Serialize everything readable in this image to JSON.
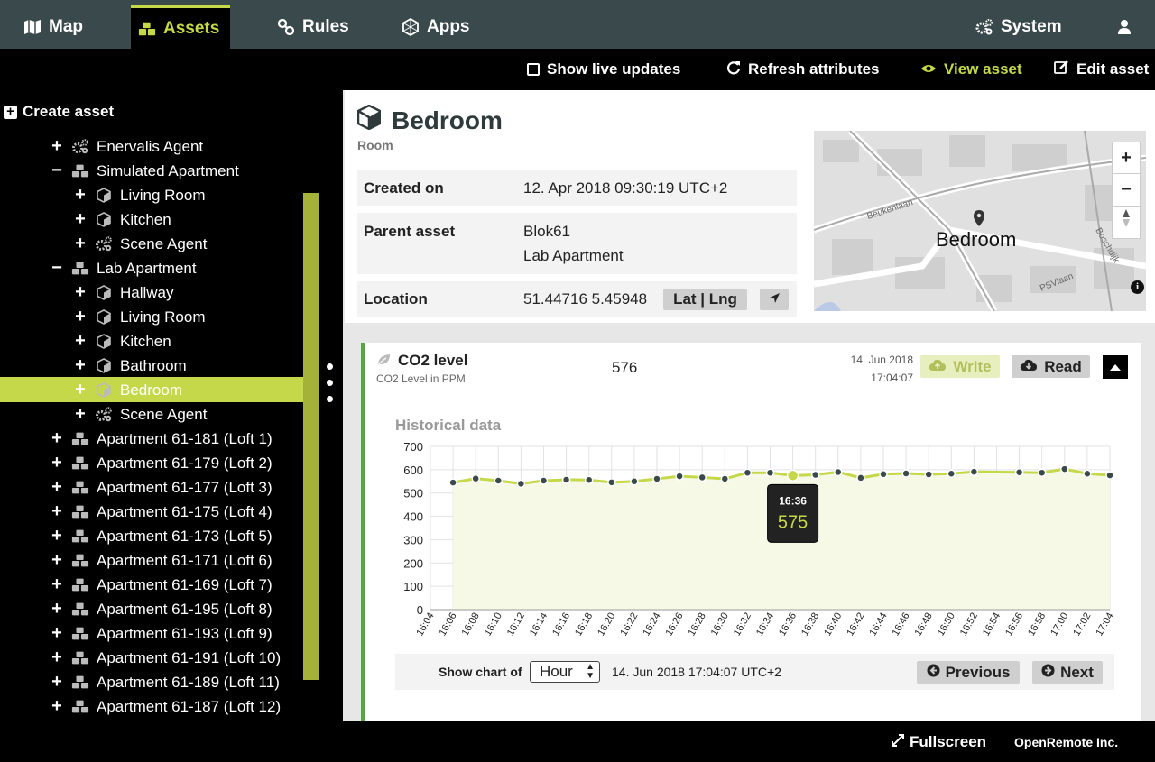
{
  "nav": {
    "items": [
      {
        "label": "Map",
        "icon": "map-icon"
      },
      {
        "label": "Assets",
        "icon": "cubes-icon"
      },
      {
        "label": "Rules",
        "icon": "link-icon"
      },
      {
        "label": "Apps",
        "icon": "apps-icon"
      }
    ],
    "system_label": "System",
    "accent": "#c4d84a"
  },
  "toolbar": {
    "live_updates": "Show live updates",
    "refresh": "Refresh attributes",
    "view": "View asset",
    "edit": "Edit asset"
  },
  "sidebar": {
    "create_label": "Create asset",
    "items": [
      {
        "label": "Enervalis Agent",
        "toggle": "+",
        "icon": "gears-icon",
        "level": 1
      },
      {
        "label": "Simulated Apartment",
        "toggle": "−",
        "icon": "cubes-icon",
        "level": 1
      },
      {
        "label": "Living Room",
        "toggle": "+",
        "icon": "cube-icon",
        "level": 2
      },
      {
        "label": "Kitchen",
        "toggle": "+",
        "icon": "cube-icon",
        "level": 2
      },
      {
        "label": "Scene Agent",
        "toggle": "+",
        "icon": "gears-icon",
        "level": 2
      },
      {
        "label": "Lab Apartment",
        "toggle": "−",
        "icon": "cubes-icon",
        "level": 1
      },
      {
        "label": "Hallway",
        "toggle": "+",
        "icon": "cube-icon",
        "level": 2
      },
      {
        "label": "Living Room",
        "toggle": "+",
        "icon": "cube-icon",
        "level": 2
      },
      {
        "label": "Kitchen",
        "toggle": "+",
        "icon": "cube-icon",
        "level": 2
      },
      {
        "label": "Bathroom",
        "toggle": "+",
        "icon": "cube-icon",
        "level": 2
      },
      {
        "label": "Bedroom",
        "toggle": "+",
        "icon": "cube-icon",
        "level": 2,
        "selected": true
      },
      {
        "label": "Scene Agent",
        "toggle": "+",
        "icon": "gears-icon",
        "level": 2
      },
      {
        "label": "Apartment 61-181 (Loft 1)",
        "toggle": "+",
        "icon": "cubes-icon",
        "level": 1
      },
      {
        "label": "Apartment 61-179 (Loft 2)",
        "toggle": "+",
        "icon": "cubes-icon",
        "level": 1
      },
      {
        "label": "Apartment 61-177 (Loft 3)",
        "toggle": "+",
        "icon": "cubes-icon",
        "level": 1
      },
      {
        "label": "Apartment 61-175 (Loft 4)",
        "toggle": "+",
        "icon": "cubes-icon",
        "level": 1
      },
      {
        "label": "Apartment 61-173 (Loft 5)",
        "toggle": "+",
        "icon": "cubes-icon",
        "level": 1
      },
      {
        "label": "Apartment 61-171 (Loft 6)",
        "toggle": "+",
        "icon": "cubes-icon",
        "level": 1
      },
      {
        "label": "Apartment 61-169 (Loft 7)",
        "toggle": "+",
        "icon": "cubes-icon",
        "level": 1
      },
      {
        "label": "Apartment 61-195 (Loft 8)",
        "toggle": "+",
        "icon": "cubes-icon",
        "level": 1
      },
      {
        "label": "Apartment 61-193 (Loft 9)",
        "toggle": "+",
        "icon": "cubes-icon",
        "level": 1
      },
      {
        "label": "Apartment 61-191 (Loft 10)",
        "toggle": "+",
        "icon": "cubes-icon",
        "level": 1
      },
      {
        "label": "Apartment 61-189 (Loft 11)",
        "toggle": "+",
        "icon": "cubes-icon",
        "level": 1
      },
      {
        "label": "Apartment 61-187 (Loft 12)",
        "toggle": "+",
        "icon": "cubes-icon",
        "level": 1
      }
    ]
  },
  "asset": {
    "name": "Bedroom",
    "type": "Room",
    "created_label": "Created on",
    "created_value": "12. Apr 2018 09:30:19 UTC+2",
    "parent_label": "Parent asset",
    "parent_line1": "Blok61",
    "parent_line2": "Lab Apartment",
    "location_label": "Location",
    "location_value": "51.44716 5.45948",
    "latlng_label": "Lat | Lng"
  },
  "map": {
    "marker_label": "Bedroom",
    "zoom_in": "+",
    "zoom_out": "−",
    "street1": "Beukenlaan",
    "street2": "Boschdijk",
    "street3": "PSVlaan"
  },
  "attribute": {
    "name": "CO2 level",
    "description": "CO2 Level in PPM",
    "value": "576",
    "time_date": "14. Jun 2018",
    "time_clock": "17:04:07",
    "write_label": "Write",
    "read_label": "Read",
    "history_title": "Historical data",
    "chart_footer": {
      "show_label": "Show chart of",
      "period": "Hour",
      "date": "14. Jun 2018 17:04:07 UTC+2",
      "prev_label": "Previous",
      "next_label": "Next"
    }
  },
  "chart_data": {
    "type": "line",
    "title": "Historical data",
    "xlabel": "",
    "ylabel": "",
    "ylim": [
      0,
      700
    ],
    "yticks": [
      0,
      100,
      200,
      300,
      400,
      500,
      600,
      700
    ],
    "xtick_labels": [
      "16:04",
      "16:06",
      "16:08",
      "16:10",
      "16:12",
      "16:14",
      "16:16",
      "16:18",
      "16:20",
      "16:22",
      "16:24",
      "16:26",
      "16:28",
      "16:30",
      "16:32",
      "16:34",
      "16:36",
      "16:38",
      "16:40",
      "16:42",
      "16:44",
      "16:46",
      "16:48",
      "16:50",
      "16:52",
      "16:54",
      "16:56",
      "16:58",
      "17:00",
      "17:02",
      "17:04"
    ],
    "x": [
      "16:06",
      "16:08",
      "16:10",
      "16:12",
      "16:14",
      "16:16",
      "16:18",
      "16:20",
      "16:22",
      "16:24",
      "16:26",
      "16:28",
      "16:30",
      "16:32",
      "16:34",
      "16:36",
      "16:38",
      "16:40",
      "16:42",
      "16:44",
      "16:46",
      "16:48",
      "16:50",
      "16:52",
      "16:56",
      "16:58",
      "17:00",
      "17:02",
      "17:04"
    ],
    "values": [
      545,
      562,
      553,
      540,
      553,
      557,
      556,
      546,
      550,
      561,
      572,
      567,
      561,
      587,
      587,
      575,
      578,
      590,
      565,
      581,
      584,
      580,
      583,
      591,
      589,
      587,
      603,
      583,
      576
    ],
    "tooltip": {
      "x": "16:36",
      "value": "575"
    },
    "grid": true,
    "line_color": "#c4d84a",
    "fill_color": "#f6f9e6",
    "point_color": "#3a4a4c"
  },
  "footer": {
    "fullscreen": "Fullscreen",
    "company": "OpenRemote Inc."
  }
}
